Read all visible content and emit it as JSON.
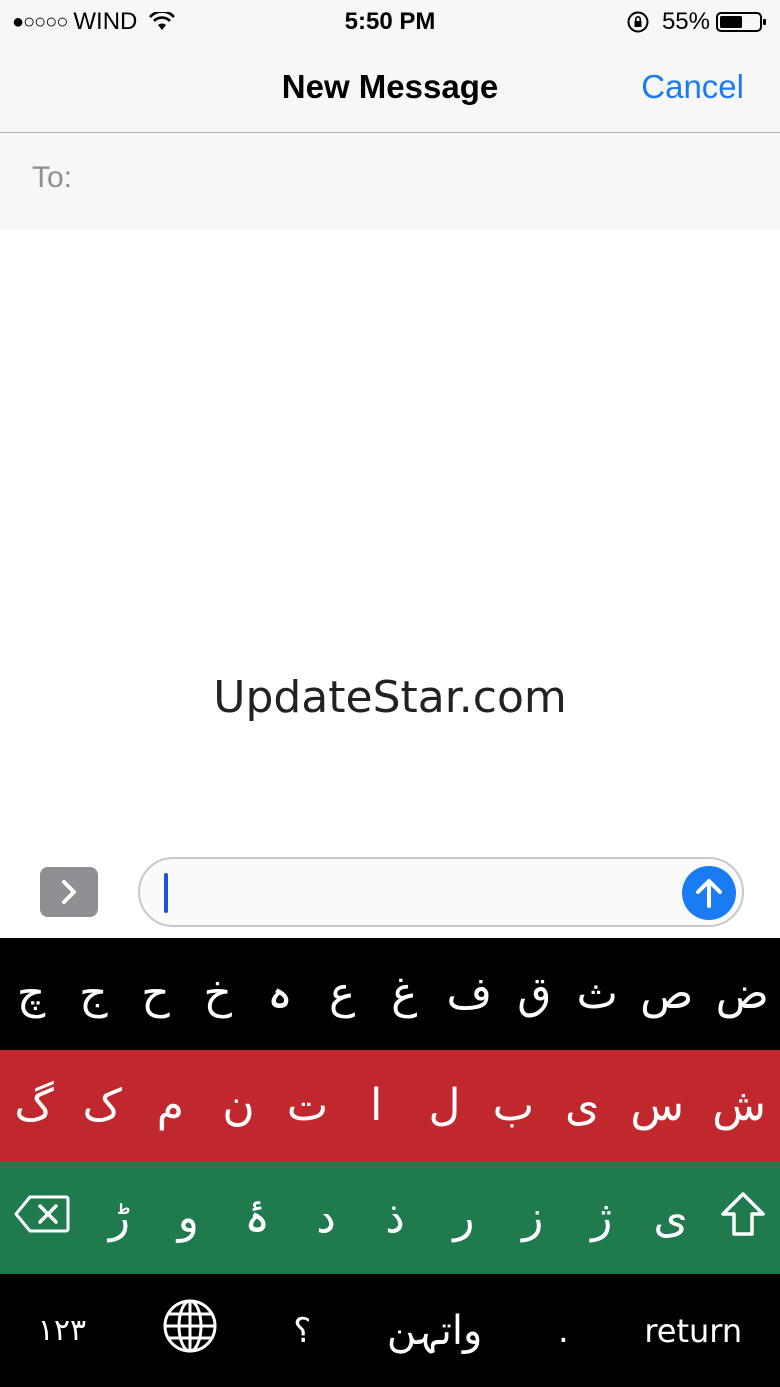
{
  "status": {
    "carrier": "WIND",
    "signal": "●○○○○",
    "time": "5:50 PM",
    "battery": "55%"
  },
  "nav": {
    "title": "New Message",
    "cancel": "Cancel"
  },
  "to": {
    "label": "To:"
  },
  "watermark": "UpdateStar.com",
  "keyboard": {
    "row1": [
      "چ",
      "ج",
      "ح",
      "خ",
      "ہ",
      "ع",
      "غ",
      "ف",
      "ق",
      "ث",
      "ص",
      "ض"
    ],
    "row2": [
      "گ",
      "ک",
      "م",
      "ن",
      "ت",
      "ا",
      "ل",
      "ب",
      "ی",
      "س",
      "ش"
    ],
    "row3": [
      "ڑ",
      "و",
      "ۂ",
      "د",
      "ذ",
      "ر",
      "ز",
      "ژ",
      "ی"
    ],
    "bottom": {
      "numbers": "۱۲۳",
      "question": "؟",
      "space": "واتہن",
      "period": ".",
      "return": "return"
    }
  },
  "colors": {
    "accent": "#1b7cf2",
    "row_black": "#000000",
    "row_red": "#c0282d",
    "row_green": "#1f7a4d"
  }
}
